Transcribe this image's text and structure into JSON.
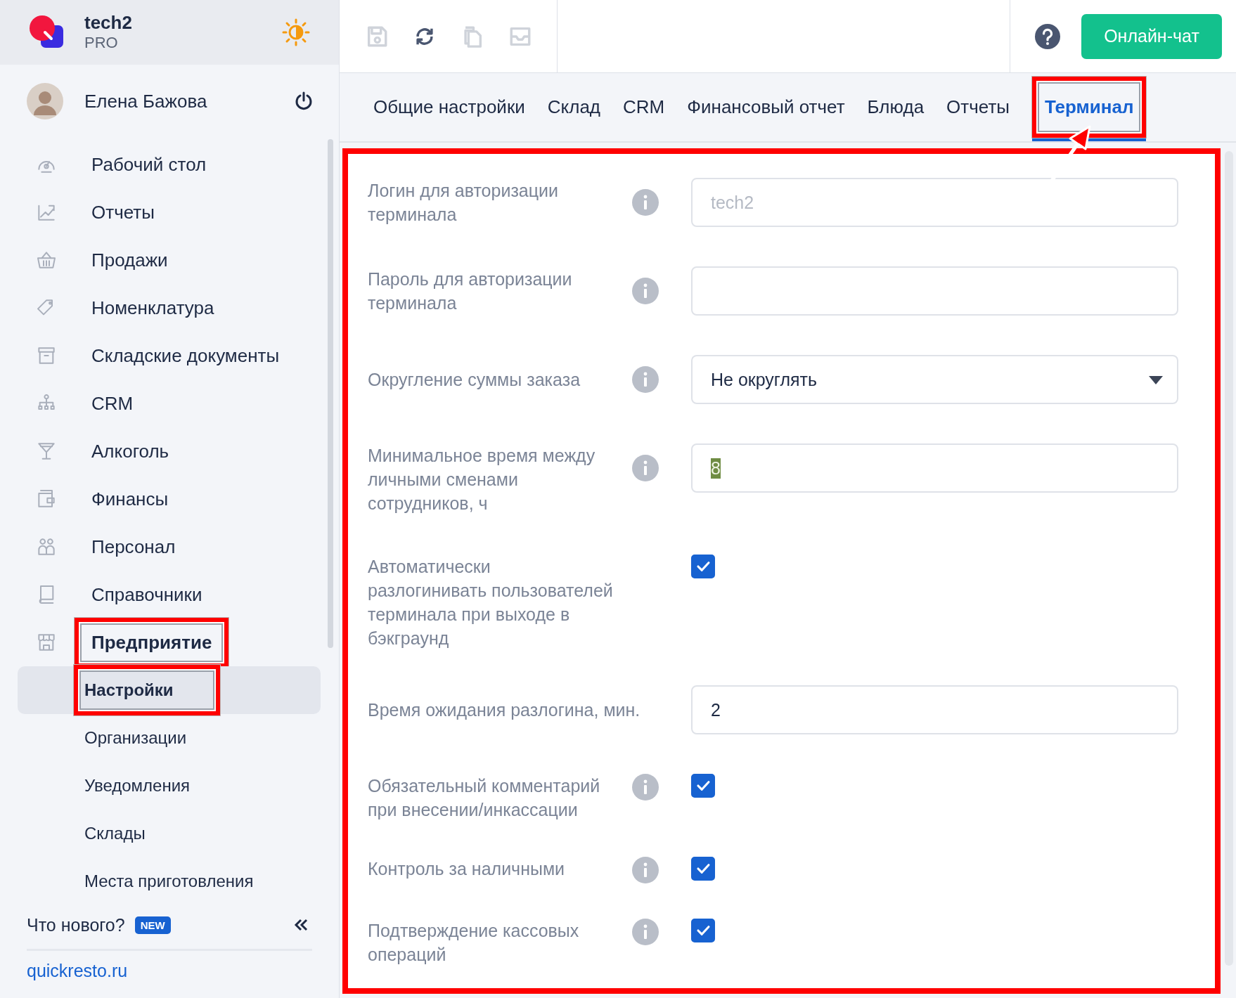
{
  "brand": {
    "name": "tech2",
    "plan": "PRO"
  },
  "user": {
    "name": "Елена Бажова"
  },
  "nav": [
    {
      "label": "Рабочий стол",
      "expanded": false,
      "highlighted": false
    },
    {
      "label": "Отчеты",
      "expanded": false,
      "highlighted": false
    },
    {
      "label": "Продажи",
      "expanded": false,
      "highlighted": false
    },
    {
      "label": "Номенклатура",
      "expanded": false,
      "highlighted": false
    },
    {
      "label": "Складские документы",
      "expanded": false,
      "highlighted": false
    },
    {
      "label": "CRM",
      "expanded": false,
      "highlighted": false
    },
    {
      "label": "Алкоголь",
      "expanded": false,
      "highlighted": false
    },
    {
      "label": "Финансы",
      "expanded": false,
      "highlighted": false
    },
    {
      "label": "Персонал",
      "expanded": false,
      "highlighted": false
    },
    {
      "label": "Справочники",
      "expanded": false,
      "highlighted": false
    },
    {
      "label": "Предприятие",
      "expanded": true,
      "highlighted": true,
      "children": [
        {
          "label": "Настройки",
          "selected": true,
          "highlighted": true
        },
        {
          "label": "Организации",
          "selected": false,
          "highlighted": false
        },
        {
          "label": "Уведомления",
          "selected": false,
          "highlighted": false
        },
        {
          "label": "Склады",
          "selected": false,
          "highlighted": false
        },
        {
          "label": "Места приготовления",
          "selected": false,
          "highlighted": false
        }
      ]
    }
  ],
  "whats_new": {
    "label": "Что нового?",
    "badge": "NEW"
  },
  "site_link": "quickresto.ru",
  "toolbar": [
    {
      "kind": "save",
      "disabled": true
    },
    {
      "kind": "sync",
      "disabled": false
    },
    {
      "kind": "copy",
      "disabled": true
    },
    {
      "kind": "tray",
      "disabled": true
    }
  ],
  "chat_button": "Онлайн-чат",
  "tabs": [
    {
      "label": "Общие настройки",
      "selected": false,
      "highlighted": false
    },
    {
      "label": "Склад",
      "selected": false,
      "highlighted": false
    },
    {
      "label": "CRM",
      "selected": false,
      "highlighted": false
    },
    {
      "label": "Финансовый отчет",
      "selected": false,
      "highlighted": false
    },
    {
      "label": "Блюда",
      "selected": false,
      "highlighted": false
    },
    {
      "label": "Отчеты",
      "selected": false,
      "highlighted": false
    },
    {
      "label": "Терминал",
      "selected": true,
      "highlighted": true
    }
  ],
  "panel": {
    "highlighted": true
  },
  "settings": [
    {
      "kind": "text",
      "label": "Логин для авторизации терминала",
      "info": true,
      "placeholder": "tech2"
    },
    {
      "kind": "text",
      "label": "Пароль для авторизации терминала",
      "info": true
    },
    {
      "kind": "select",
      "label": "Округление суммы заказа",
      "info": true,
      "value": "Не округлять"
    },
    {
      "kind": "text",
      "label": "Минимальное время между личными сменами сотрудников, ч",
      "info": true,
      "value": "8",
      "selected": true
    },
    {
      "kind": "checkbox",
      "label": "Автоматически разлогинивать пользователей терминала при выходе в бэкграунд",
      "checked": true
    },
    {
      "kind": "text",
      "label": "Время ожидания разлогина, мин.",
      "value": "2",
      "selected": false
    },
    {
      "kind": "checkbox",
      "label": "Обязательный комментарий при внесении/инкассации",
      "info": true,
      "checked": true
    },
    {
      "kind": "checkbox",
      "label": "Контроль за наличными",
      "info": true,
      "checked": true
    },
    {
      "kind": "checkbox",
      "label": "Подтверждение кассовых операций",
      "info": true,
      "checked": true
    }
  ]
}
